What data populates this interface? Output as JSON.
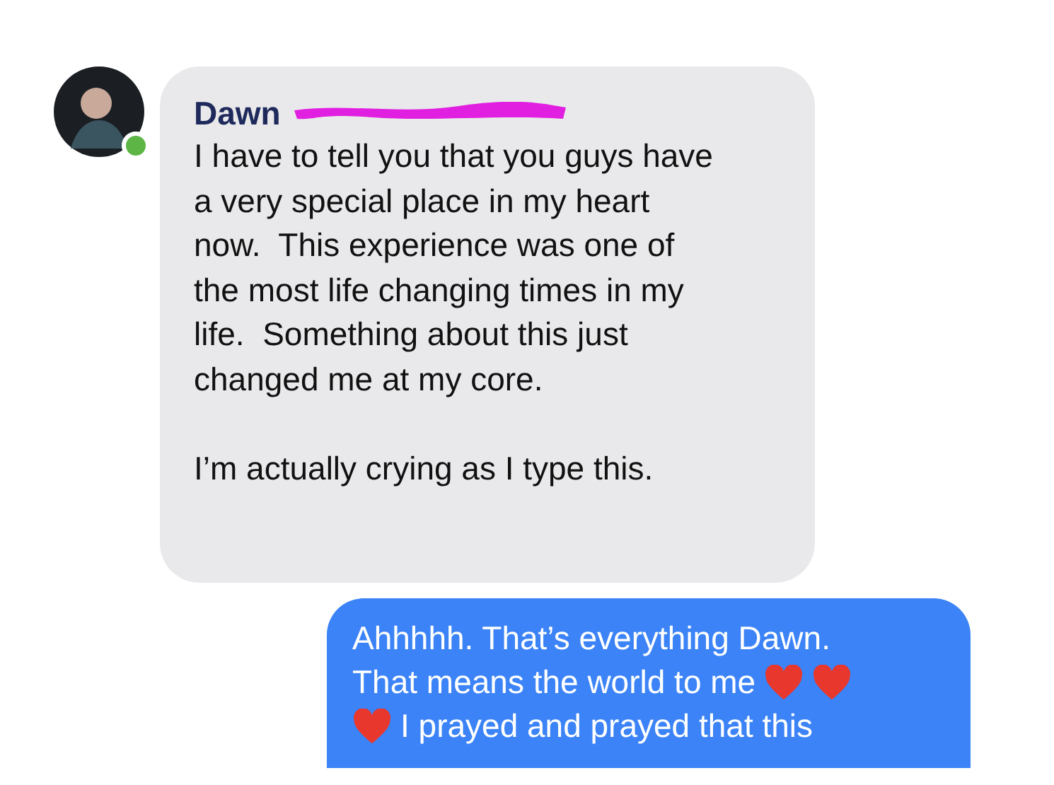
{
  "incoming": {
    "sender": "Dawn",
    "online": true,
    "name_redacted": true,
    "paragraphs": [
      [
        "I have to tell you that you guys have",
        "a very special place in my heart",
        "now.  This experience was one of",
        "the most life changing times in my",
        "life.  Something about this just",
        "changed me at my core."
      ],
      [
        "I’m actually crying as I type this."
      ]
    ]
  },
  "outgoing": {
    "lines": [
      [
        {
          "kind": "text",
          "text": "Ahhhhh. That’s everything Dawn."
        }
      ],
      [
        {
          "kind": "text",
          "text": "That means the world to me"
        },
        {
          "kind": "heart"
        },
        {
          "kind": "heart"
        }
      ],
      [
        {
          "kind": "heart"
        },
        {
          "kind": "text",
          "text": "I prayed and prayed that this"
        }
      ]
    ]
  }
}
